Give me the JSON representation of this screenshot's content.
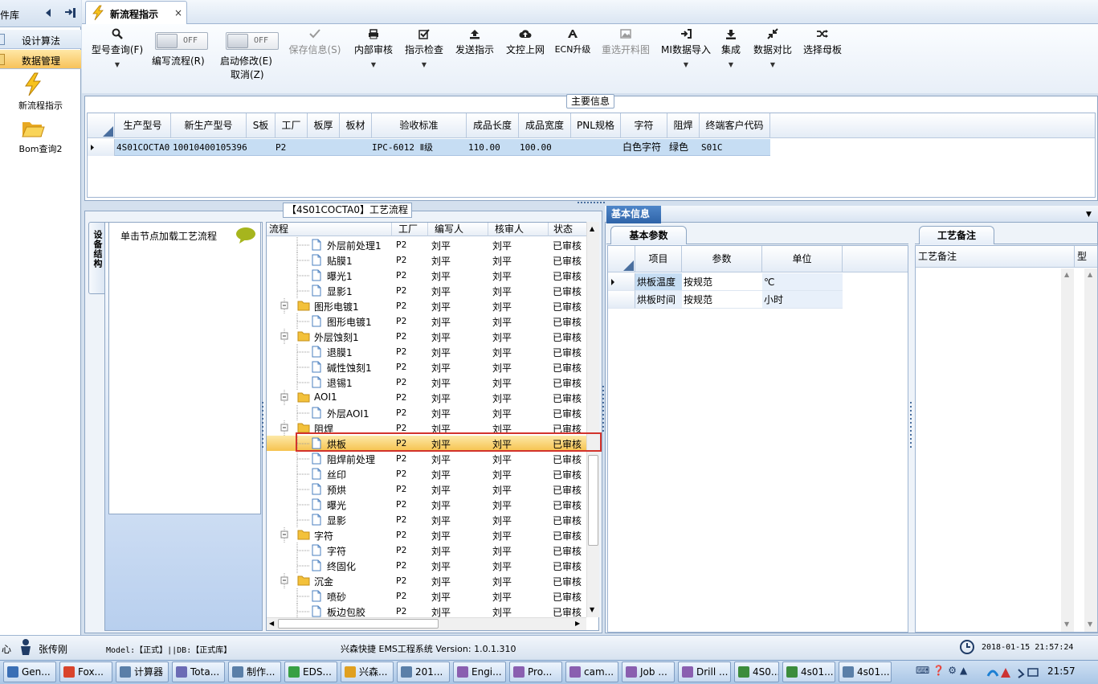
{
  "sidebar": {
    "title": "件库",
    "tabs": [
      {
        "label": "设计算法"
      },
      {
        "label": "数据管理"
      }
    ],
    "items": [
      {
        "label": "新流程指示"
      },
      {
        "label": "Bom查询2"
      }
    ]
  },
  "document_tab": {
    "label": "新流程指示",
    "close": "×"
  },
  "toolbar": {
    "model_query": "型号查询(F)",
    "edit_flow": "编写流程(R)",
    "edit_flow_toggle": "OFF",
    "start_modify": "启动修改(E)",
    "start_modify_toggle": "OFF",
    "cancel": "取消(Z)",
    "save_info": "保存信息(S)",
    "internal_review": "内部审核",
    "instruction_check": "指示检查",
    "send_instruction": "发送指示",
    "doc_upload": "文控上网",
    "ecn_upgrade": "ECN升级",
    "reselect_cut_drawing": "重选开料图",
    "mi_import": "MI数据导入",
    "integrate": "集成",
    "data_compare": "数据对比",
    "select_master": "选择母板"
  },
  "main_info": {
    "legend": "主要信息",
    "columns": [
      "生产型号",
      "新生产型号",
      "S板",
      "工厂",
      "板厚",
      "板材",
      "验收标准",
      "成品长度",
      "成品宽度",
      "PNL规格",
      "字符",
      "阻焊",
      "终端客户代码"
    ],
    "row": {
      "prod_model": "4S01COCTA0",
      "new_model": "10010400105396",
      "s_board": "",
      "factory": "P2",
      "thickness": "",
      "material": "",
      "standard": "IPC-6012 Ⅱ级",
      "length": "110.00",
      "width": "100.00",
      "pnl": "",
      "character": "白色字符",
      "solder_mask": "绿色",
      "customer_code": "S01C"
    }
  },
  "process_panel": {
    "legend": "【4S01COCTA0】工艺流程",
    "side_tab": "设备结构",
    "node_hint": "单击节点加载工艺流程",
    "columns": [
      "流程",
      "工厂",
      "编写人",
      "核审人",
      "状态"
    ],
    "rows": [
      {
        "name": "外层前处理1",
        "type": "file",
        "factory": "P2",
        "writer": "刘平",
        "reviewer": "刘平",
        "status": "已审核"
      },
      {
        "name": "贴膜1",
        "type": "file",
        "factory": "P2",
        "writer": "刘平",
        "reviewer": "刘平",
        "status": "已审核"
      },
      {
        "name": "曝光1",
        "type": "file",
        "factory": "P2",
        "writer": "刘平",
        "reviewer": "刘平",
        "status": "已审核"
      },
      {
        "name": "显影1",
        "type": "file",
        "factory": "P2",
        "writer": "刘平",
        "reviewer": "刘平",
        "status": "已审核"
      },
      {
        "name": "图形电镀1",
        "type": "folder",
        "factory": "P2",
        "writer": "刘平",
        "reviewer": "刘平",
        "status": "已审核"
      },
      {
        "name": "图形电镀1",
        "type": "file",
        "factory": "P2",
        "writer": "刘平",
        "reviewer": "刘平",
        "status": "已审核"
      },
      {
        "name": "外层蚀刻1",
        "type": "folder",
        "factory": "P2",
        "writer": "刘平",
        "reviewer": "刘平",
        "status": "已审核"
      },
      {
        "name": "退膜1",
        "type": "file",
        "factory": "P2",
        "writer": "刘平",
        "reviewer": "刘平",
        "status": "已审核"
      },
      {
        "name": "碱性蚀刻1",
        "type": "file",
        "factory": "P2",
        "writer": "刘平",
        "reviewer": "刘平",
        "status": "已审核"
      },
      {
        "name": "退锡1",
        "type": "file",
        "factory": "P2",
        "writer": "刘平",
        "reviewer": "刘平",
        "status": "已审核"
      },
      {
        "name": "AOI1",
        "type": "folder",
        "factory": "P2",
        "writer": "刘平",
        "reviewer": "刘平",
        "status": "已审核"
      },
      {
        "name": "外层AOI1",
        "type": "file",
        "factory": "P2",
        "writer": "刘平",
        "reviewer": "刘平",
        "status": "已审核"
      },
      {
        "name": "阻焊",
        "type": "folder",
        "factory": "P2",
        "writer": "刘平",
        "reviewer": "刘平",
        "status": "已审核"
      },
      {
        "name": "烘板",
        "type": "file",
        "factory": "P2",
        "writer": "刘平",
        "reviewer": "刘平",
        "status": "已审核",
        "selected": true
      },
      {
        "name": "阻焊前处理",
        "type": "file",
        "factory": "P2",
        "writer": "刘平",
        "reviewer": "刘平",
        "status": "已审核"
      },
      {
        "name": "丝印",
        "type": "file",
        "factory": "P2",
        "writer": "刘平",
        "reviewer": "刘平",
        "status": "已审核"
      },
      {
        "name": "预烘",
        "type": "file",
        "factory": "P2",
        "writer": "刘平",
        "reviewer": "刘平",
        "status": "已审核"
      },
      {
        "name": "曝光",
        "type": "file",
        "factory": "P2",
        "writer": "刘平",
        "reviewer": "刘平",
        "status": "已审核"
      },
      {
        "name": "显影",
        "type": "file",
        "factory": "P2",
        "writer": "刘平",
        "reviewer": "刘平",
        "status": "已审核"
      },
      {
        "name": "字符",
        "type": "folder",
        "factory": "P2",
        "writer": "刘平",
        "reviewer": "刘平",
        "status": "已审核"
      },
      {
        "name": "字符",
        "type": "file",
        "factory": "P2",
        "writer": "刘平",
        "reviewer": "刘平",
        "status": "已审核"
      },
      {
        "name": "终固化",
        "type": "file",
        "factory": "P2",
        "writer": "刘平",
        "reviewer": "刘平",
        "status": "已审核"
      },
      {
        "name": "沉金",
        "type": "folder",
        "factory": "P2",
        "writer": "刘平",
        "reviewer": "刘平",
        "status": "已审核"
      },
      {
        "name": "喷砂",
        "type": "file",
        "factory": "P2",
        "writer": "刘平",
        "reviewer": "刘平",
        "status": "已审核"
      },
      {
        "name": "板边包胶",
        "type": "file",
        "factory": "P2",
        "writer": "刘平",
        "reviewer": "刘平",
        "status": "已审核"
      }
    ]
  },
  "info_panel": {
    "tab": "基本信息",
    "params_tab": "基本参数",
    "params_columns": [
      "项目",
      "参数",
      "单位"
    ],
    "params": [
      {
        "item": "烘板温度",
        "value": "按规范",
        "unit": "℃"
      },
      {
        "item": "烘板时间",
        "value": "按规范",
        "unit": "小时"
      }
    ],
    "remarks_tab": "工艺备注",
    "remarks_columns": [
      "工艺备注",
      "型"
    ]
  },
  "status_bar": {
    "left": "心",
    "user": "张传刚",
    "model_db": "Model:【正式】||DB:【正式库】",
    "system": "兴森快捷 EMS工程系统 Version: 1.0.1.310",
    "datetime": "2018-01-15 21:57:24"
  },
  "taskbar": {
    "tasks": [
      {
        "label": "Gen...",
        "color": "#3a6fb5"
      },
      {
        "label": "Fox...",
        "color": "#d9442c"
      },
      {
        "label": "计算器",
        "color": "#5a7fa8"
      },
      {
        "label": "Tota...",
        "color": "#6b6bb5"
      },
      {
        "label": "制作...",
        "color": "#5a7fa8"
      },
      {
        "label": "EDS...",
        "color": "#38a044"
      },
      {
        "label": "兴森...",
        "color": "#e0a020"
      },
      {
        "label": "201...",
        "color": "#5a7fa8"
      },
      {
        "label": "Engi...",
        "color": "#8a5fb0"
      },
      {
        "label": "Pro...",
        "color": "#8a5fb0"
      },
      {
        "label": "cam...",
        "color": "#8a5fb0"
      },
      {
        "label": "Job ...",
        "color": "#8a5fb0"
      },
      {
        "label": "Drill ...",
        "color": "#8a5fb0"
      },
      {
        "label": "4S0...",
        "color": "#3c8c3c"
      },
      {
        "label": "4s01...",
        "color": "#3c8c3c"
      },
      {
        "label": "4s01...",
        "color": "#5a7fa8"
      }
    ],
    "clock": "21:57"
  }
}
